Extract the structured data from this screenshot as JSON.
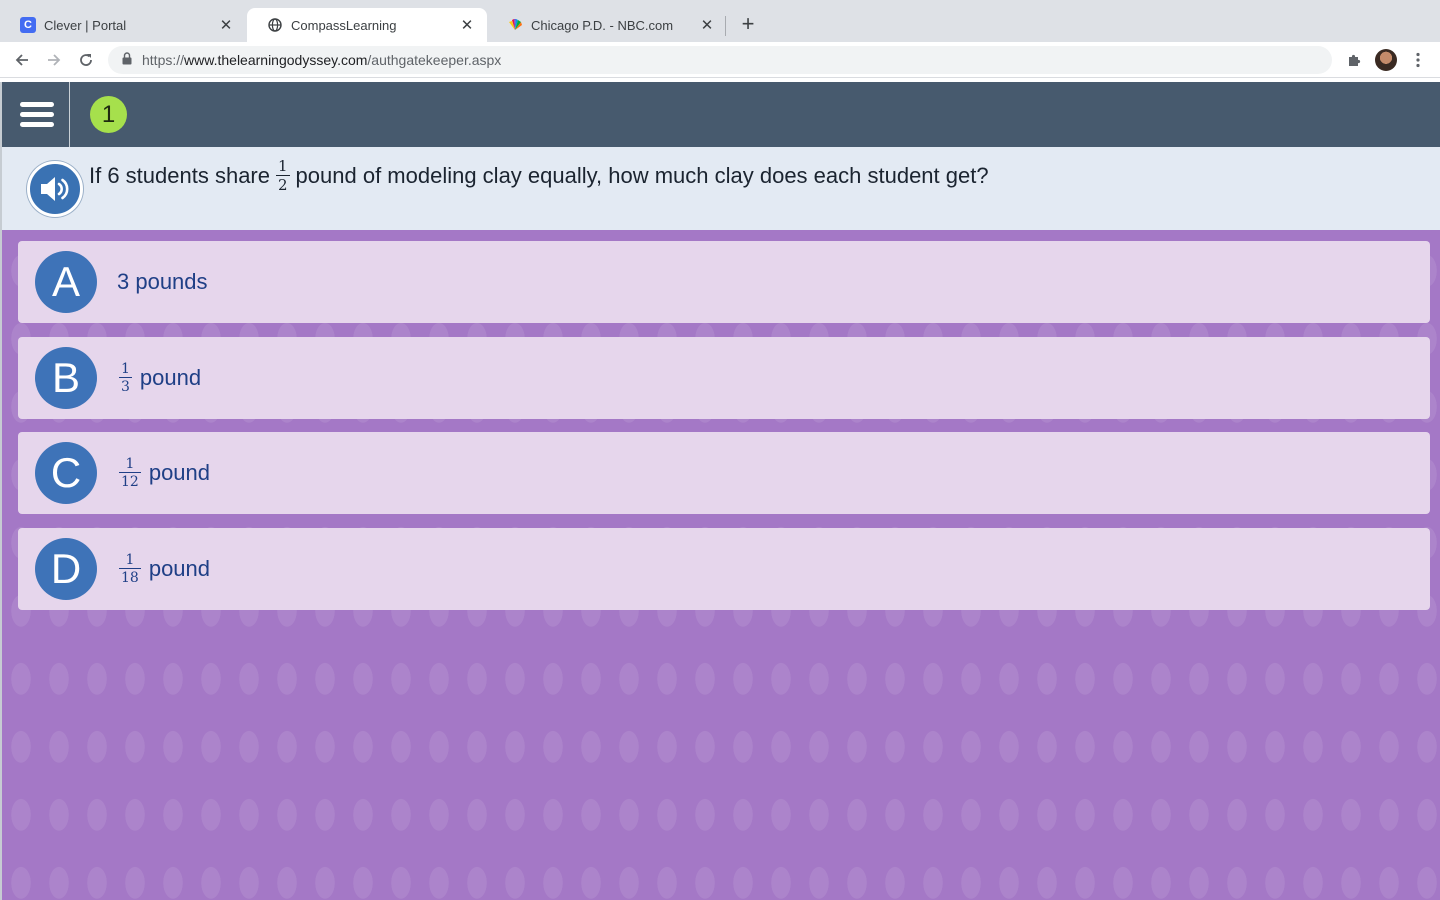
{
  "browser": {
    "tabs": [
      {
        "title": "Clever | Portal",
        "favicon": "clever-icon",
        "active": false
      },
      {
        "title": "CompassLearning",
        "favicon": "globe-icon",
        "active": true
      },
      {
        "title": "Chicago P.D. - NBC.com",
        "favicon": "nbc-peacock-icon",
        "active": false
      }
    ],
    "close_glyph": "✕",
    "new_tab_glyph": "+",
    "url": {
      "scheme": "https://",
      "host": "www.thelearningodyssey.com",
      "path": "/authgatekeeper.aspx"
    }
  },
  "app": {
    "question_number": "1",
    "question": {
      "before": "If 6 students share",
      "fraction": {
        "numerator": "1",
        "denominator": "2"
      },
      "after": "pound of modeling clay equally, how much clay does each student get?"
    },
    "answers": [
      {
        "letter": "A",
        "fraction": null,
        "text": "3 pounds"
      },
      {
        "letter": "B",
        "fraction": {
          "numerator": "1",
          "denominator": "3"
        },
        "text": "pound"
      },
      {
        "letter": "C",
        "fraction": {
          "numerator": "1",
          "denominator": "12"
        },
        "text": "pound"
      },
      {
        "letter": "D",
        "fraction": {
          "numerator": "1",
          "denominator": "18"
        },
        "text": "pound"
      }
    ]
  },
  "colors": {
    "header": "#475a6e",
    "question_bg": "#e3eaf3",
    "question_number_badge": "#a6e04c",
    "answers_background": "#a478c6",
    "answer_card": "#e6d6ec",
    "letter_circle": "#3e73b8",
    "answer_text": "#1f3f86"
  }
}
